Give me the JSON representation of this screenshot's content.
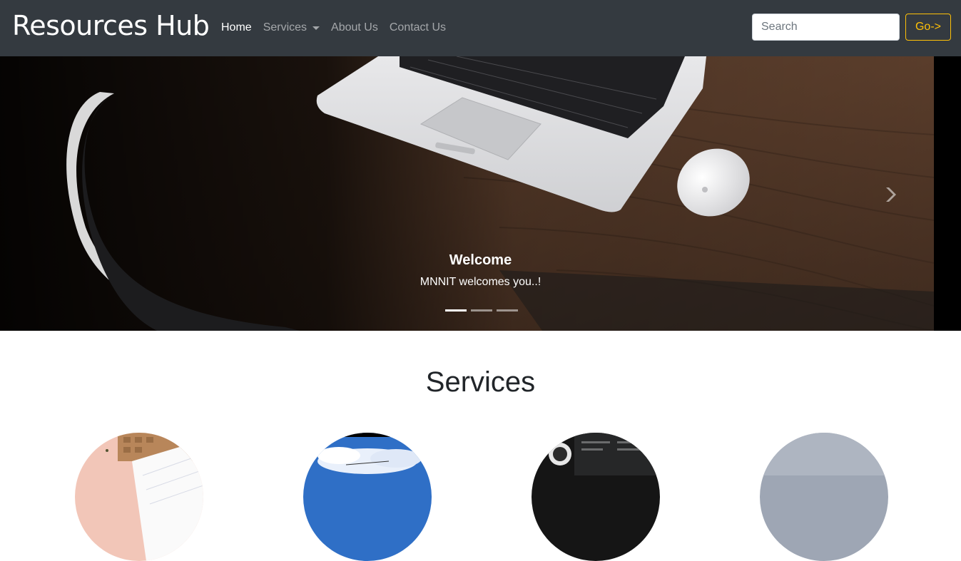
{
  "navbar": {
    "brand": "Resources Hub",
    "links": [
      {
        "label": "Home",
        "active": true
      },
      {
        "label": "Services",
        "dropdown": true
      },
      {
        "label": "About Us"
      },
      {
        "label": "Contact Us"
      }
    ],
    "search": {
      "placeholder": "Search",
      "value": ""
    },
    "go_button": "Go->"
  },
  "carousel": {
    "slide_image": "laptop-on-desk-photo",
    "caption_title": "Welcome",
    "caption_text": "MNNIT welcomes you..!",
    "indicator_count": 3,
    "active_indicator": 0,
    "next_icon": "chevron-right-icon"
  },
  "services": {
    "title": "Services",
    "items": [
      {
        "image": "notebook-desk-photo"
      },
      {
        "image": "sky-clouds-photo"
      },
      {
        "image": "dark-workspace-photo"
      },
      {
        "image": "gray-sky-photo"
      }
    ]
  },
  "colors": {
    "navbar_bg": "#343a40",
    "accent_warning": "#ffc107",
    "text_dark": "#212529"
  }
}
